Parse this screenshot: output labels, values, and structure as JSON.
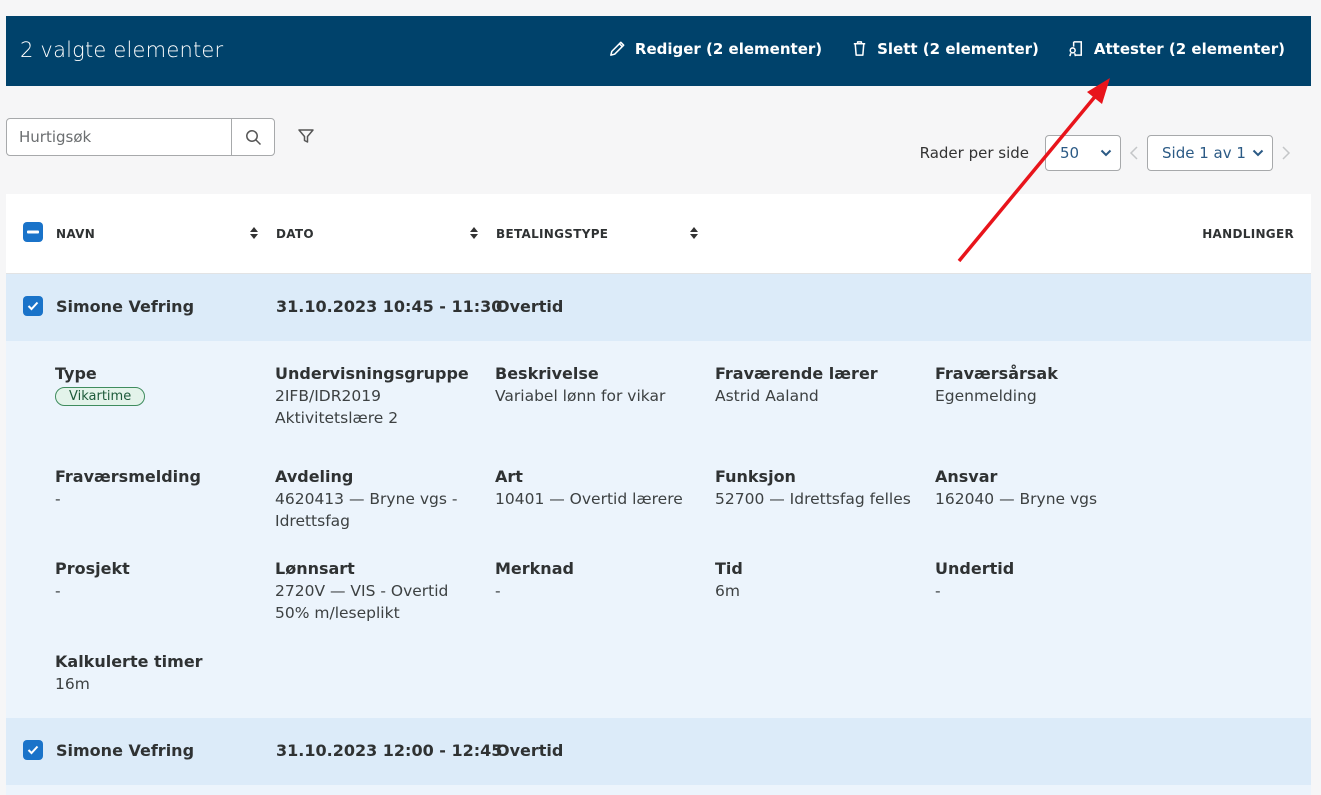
{
  "topbar": {
    "title": "2 valgte elementer",
    "edit_label": "Rediger (2 elementer)",
    "delete_label": "Slett (2 elementer)",
    "attest_label": "Attester (2 elementer)"
  },
  "search": {
    "placeholder": "Hurtigsøk"
  },
  "pager": {
    "rows_label": "Rader per side",
    "rows_value": "50",
    "page_value": "Side 1 av 1"
  },
  "table": {
    "columns": {
      "name": "NAVN",
      "date": "DATO",
      "paytype": "BETALINGSTYPE",
      "actions": "HANDLINGER"
    },
    "rows": [
      {
        "name": "Simone Vefring",
        "date": "31.10.2023 10:45 - 11:30",
        "paytype": "Overtid",
        "details": [
          {
            "key": "Type",
            "tag": "Vikartime"
          },
          {
            "key": "Undervisningsgruppe",
            "value": "2IFB/IDR2019\nAktivitetslære 2"
          },
          {
            "key": "Beskrivelse",
            "value": "Variabel lønn for vikar"
          },
          {
            "key": "Fraværende lærer",
            "value": "Astrid Aaland"
          },
          {
            "key": "Fraværsårsak",
            "value": "Egenmelding"
          },
          {
            "key": "Fraværsmelding",
            "value": "-"
          },
          {
            "key": "Avdeling",
            "value": "4620413 — Bryne vgs -\nIdrettsfag"
          },
          {
            "key": "Art",
            "value": "10401 — Overtid lærere"
          },
          {
            "key": "Funksjon",
            "value": "52700 — Idrettsfag felles"
          },
          {
            "key": "Ansvar",
            "value": "162040 — Bryne vgs"
          },
          {
            "key": "Prosjekt",
            "value": "-"
          },
          {
            "key": "Lønnsart",
            "value": "2720V — VIS - Overtid\n50% m/leseplikt"
          },
          {
            "key": "Merknad",
            "value": "-"
          },
          {
            "key": "Tid",
            "value": "6m"
          },
          {
            "key": "Undertid",
            "value": "-"
          },
          {
            "key": "Kalkulerte timer",
            "value": "16m"
          }
        ]
      },
      {
        "name": "Simone Vefring",
        "date": "31.10.2023 12:00 - 12:45",
        "paytype": "Overtid"
      }
    ]
  },
  "colors": {
    "topbar": "#00426b",
    "accent": "#1a73c9",
    "row_selected": "#dcebf9",
    "annotation_arrow": "#e8141b"
  },
  "icons": [
    "pencil-icon",
    "trash-icon",
    "attest-icon",
    "search-icon",
    "filter-icon",
    "chevron-down-icon",
    "chevron-left-icon",
    "chevron-right-icon",
    "sort-icon",
    "checkbox-checked-icon",
    "checkbox-indeterminate-icon"
  ]
}
